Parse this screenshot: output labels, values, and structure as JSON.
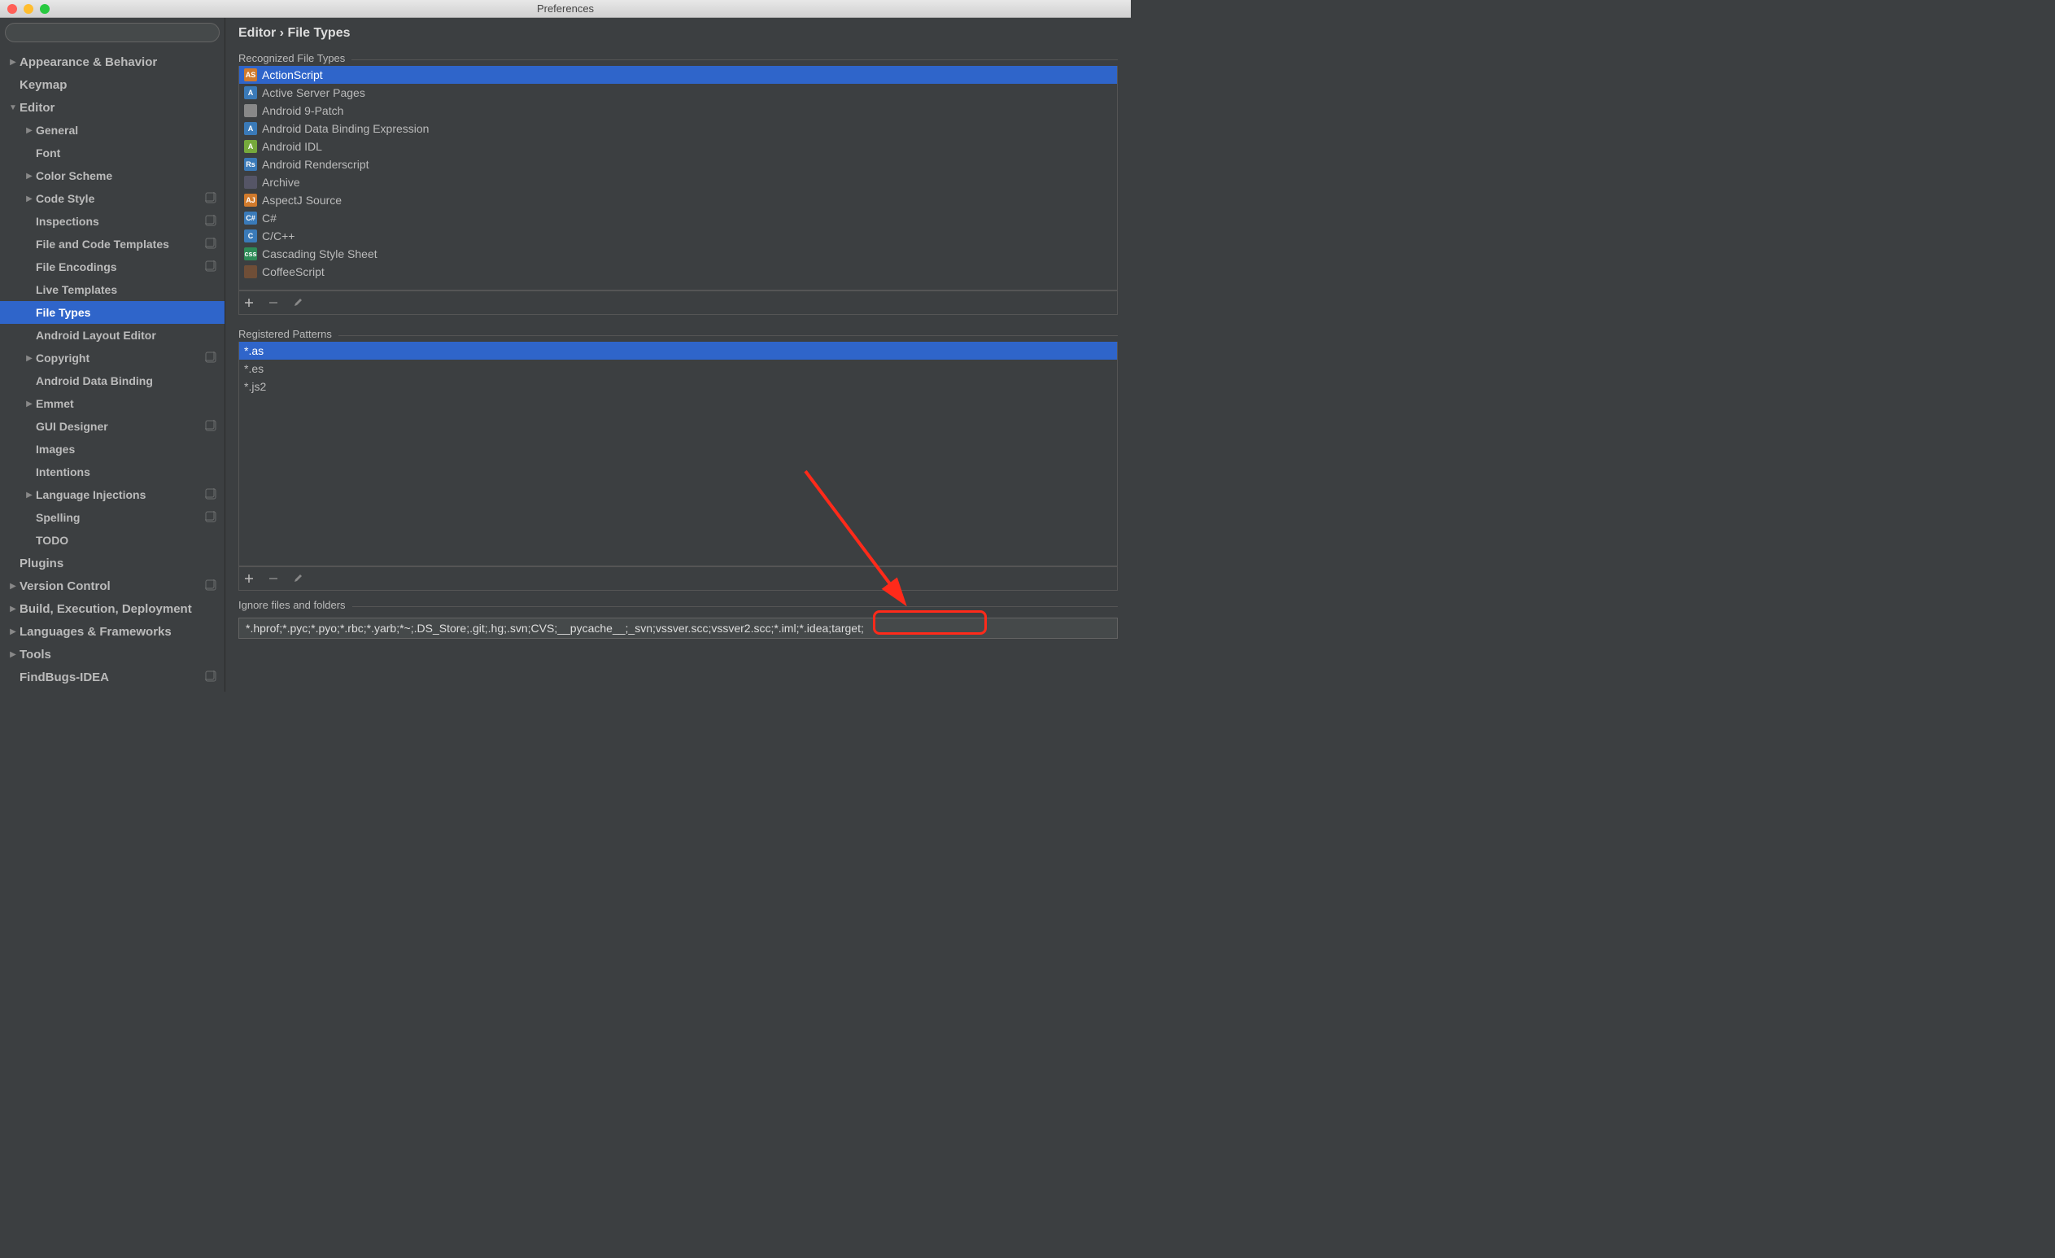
{
  "window": {
    "title": "Preferences"
  },
  "search": {
    "placeholder": ""
  },
  "breadcrumb": "Editor › File Types",
  "sidebar": {
    "items": [
      {
        "label": "Appearance & Behavior",
        "indent": 0,
        "arrow": "right",
        "top": true
      },
      {
        "label": "Keymap",
        "indent": 0,
        "arrow": "none",
        "top": true
      },
      {
        "label": "Editor",
        "indent": 0,
        "arrow": "down",
        "top": true
      },
      {
        "label": "General",
        "indent": 1,
        "arrow": "right"
      },
      {
        "label": "Font",
        "indent": 1,
        "arrow": "none"
      },
      {
        "label": "Color Scheme",
        "indent": 1,
        "arrow": "right"
      },
      {
        "label": "Code Style",
        "indent": 1,
        "arrow": "right",
        "badge": true
      },
      {
        "label": "Inspections",
        "indent": 1,
        "arrow": "none",
        "badge": true
      },
      {
        "label": "File and Code Templates",
        "indent": 1,
        "arrow": "none",
        "badge": true
      },
      {
        "label": "File Encodings",
        "indent": 1,
        "arrow": "none",
        "badge": true
      },
      {
        "label": "Live Templates",
        "indent": 1,
        "arrow": "none"
      },
      {
        "label": "File Types",
        "indent": 1,
        "arrow": "none",
        "selected": true
      },
      {
        "label": "Android Layout Editor",
        "indent": 1,
        "arrow": "none"
      },
      {
        "label": "Copyright",
        "indent": 1,
        "arrow": "right",
        "badge": true
      },
      {
        "label": "Android Data Binding",
        "indent": 1,
        "arrow": "none"
      },
      {
        "label": "Emmet",
        "indent": 1,
        "arrow": "right"
      },
      {
        "label": "GUI Designer",
        "indent": 1,
        "arrow": "none",
        "badge": true
      },
      {
        "label": "Images",
        "indent": 1,
        "arrow": "none"
      },
      {
        "label": "Intentions",
        "indent": 1,
        "arrow": "none"
      },
      {
        "label": "Language Injections",
        "indent": 1,
        "arrow": "right",
        "badge": true
      },
      {
        "label": "Spelling",
        "indent": 1,
        "arrow": "none",
        "badge": true
      },
      {
        "label": "TODO",
        "indent": 1,
        "arrow": "none"
      },
      {
        "label": "Plugins",
        "indent": 0,
        "arrow": "none",
        "top": true
      },
      {
        "label": "Version Control",
        "indent": 0,
        "arrow": "right",
        "top": true,
        "badge": true
      },
      {
        "label": "Build, Execution, Deployment",
        "indent": 0,
        "arrow": "right",
        "top": true
      },
      {
        "label": "Languages & Frameworks",
        "indent": 0,
        "arrow": "right",
        "top": true
      },
      {
        "label": "Tools",
        "indent": 0,
        "arrow": "right",
        "top": true
      },
      {
        "label": "FindBugs-IDEA",
        "indent": 0,
        "arrow": "none",
        "top": true,
        "badge": true
      }
    ]
  },
  "sections": {
    "recognized": "Recognized File Types",
    "patterns": "Registered Patterns",
    "ignore": "Ignore files and folders"
  },
  "fileTypes": [
    {
      "label": "ActionScript",
      "selected": true,
      "iconBg": "#d07a2c",
      "iconFg": "#fff",
      "iconText": "AS"
    },
    {
      "label": "Active Server Pages",
      "iconBg": "#3a7ab8",
      "iconFg": "#fff",
      "iconText": "A"
    },
    {
      "label": "Android 9-Patch",
      "iconBg": "#888",
      "iconFg": "#fff",
      "iconText": ""
    },
    {
      "label": "Android Data Binding Expression",
      "iconBg": "#3a7ab8",
      "iconFg": "#fff",
      "iconText": "A"
    },
    {
      "label": "Android IDL",
      "iconBg": "#76a93c",
      "iconFg": "#fff",
      "iconText": "A"
    },
    {
      "label": "Android Renderscript",
      "iconBg": "#3a7ab8",
      "iconFg": "#fff",
      "iconText": "Rs"
    },
    {
      "label": "Archive",
      "iconBg": "#556",
      "iconFg": "#fff",
      "iconText": ""
    },
    {
      "label": "AspectJ Source",
      "iconBg": "#d07a2c",
      "iconFg": "#fff",
      "iconText": "AJ"
    },
    {
      "label": "C#",
      "iconBg": "#3a7ab8",
      "iconFg": "#fff",
      "iconText": "C#"
    },
    {
      "label": "C/C++",
      "iconBg": "#3a7ab8",
      "iconFg": "#fff",
      "iconText": "C"
    },
    {
      "label": "Cascading Style Sheet",
      "iconBg": "#2e8b57",
      "iconFg": "#fff",
      "iconText": "css"
    },
    {
      "label": "CoffeeScript",
      "iconBg": "#6f4e37",
      "iconFg": "#fff",
      "iconText": ""
    }
  ],
  "patternsList": [
    {
      "label": "*.as",
      "selected": true
    },
    {
      "label": "*.es"
    },
    {
      "label": "*.js2"
    }
  ],
  "ignoreValue": "*.hprof;*.pyc;*.pyo;*.rbc;*.yarb;*~;.DS_Store;.git;.hg;.svn;CVS;__pycache__;_svn;vssver.scc;vssver2.scc;*.iml;*.idea;target;"
}
